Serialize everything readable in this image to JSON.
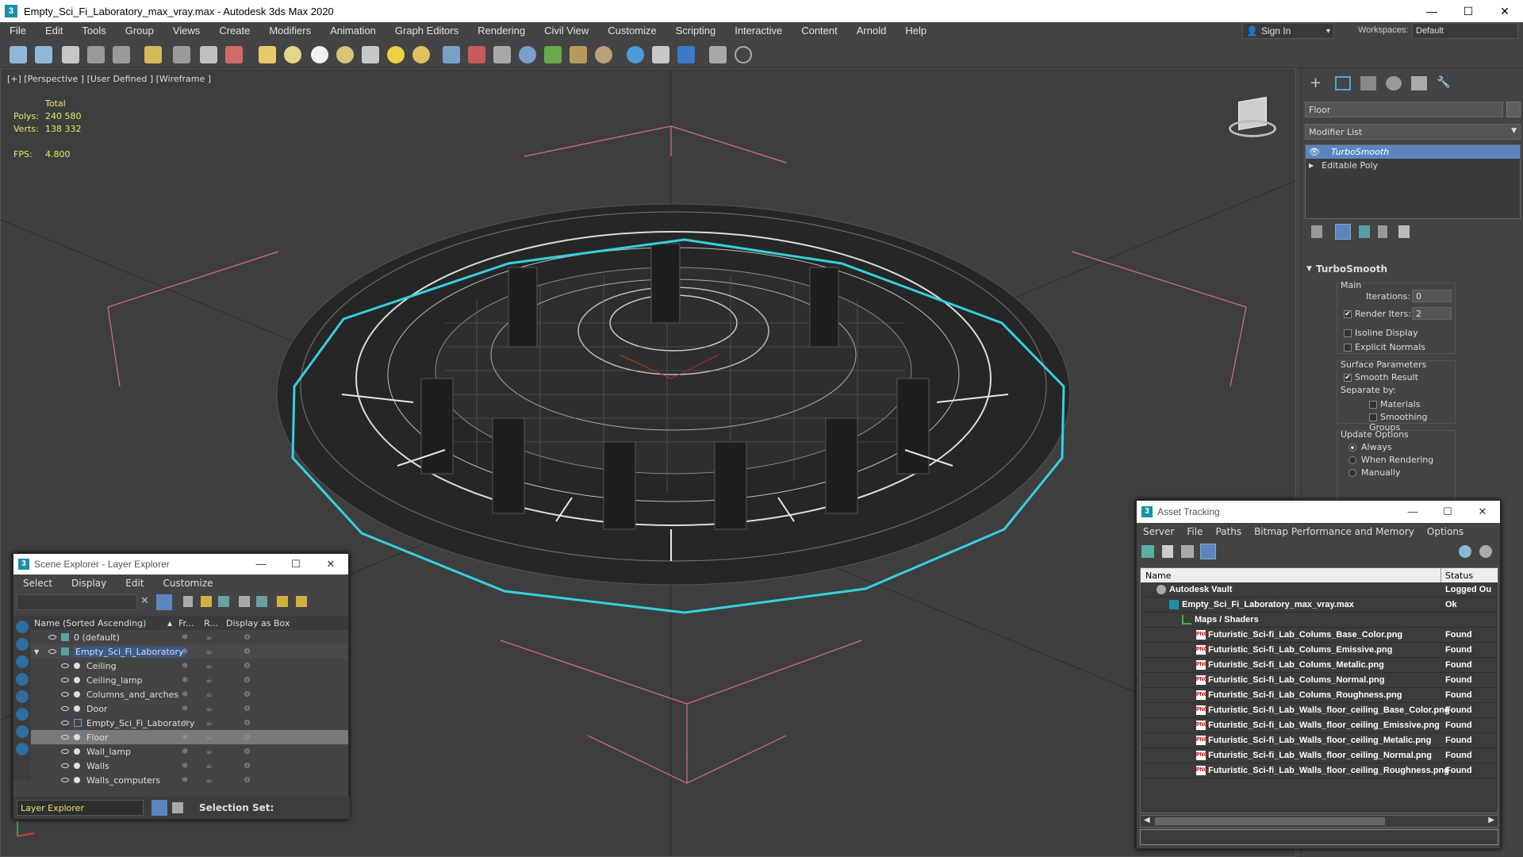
{
  "window": {
    "title": "Empty_Sci_Fi_Laboratory_max_vray.max - Autodesk 3ds Max 2020",
    "minimize": "—",
    "maximize": "☐",
    "close": "✕"
  },
  "menu": [
    "File",
    "Edit",
    "Tools",
    "Group",
    "Views",
    "Create",
    "Modifiers",
    "Animation",
    "Graph Editors",
    "Rendering",
    "Civil View",
    "Customize",
    "Scripting",
    "Interactive",
    "Content",
    "Arnold",
    "Help"
  ],
  "signin": {
    "label": "Sign In",
    "arrow": "▾"
  },
  "workspace": {
    "label": "Workspaces:",
    "value": "Default"
  },
  "viewport": {
    "label": "[+] [Perspective ] [User Defined ] [Wireframe ]",
    "stats": {
      "total_label": "Total",
      "polys_label": "Polys:",
      "polys": "240 580",
      "verts_label": "Verts:",
      "verts": "138 332",
      "fps_label": "FPS:",
      "fps": "4.800"
    }
  },
  "command_panel": {
    "object_name": "Floor",
    "modifier_list": "Modifier List",
    "stack": [
      "TurboSmooth",
      "Editable Poly"
    ],
    "rollout": {
      "title": "TurboSmooth",
      "main": "Main",
      "iterations_label": "Iterations:",
      "iterations": "0",
      "render_iters_label": "Render Iters:",
      "render_iters": "2",
      "isoline": "Isoline Display",
      "explicit": "Explicit Normals",
      "surface": "Surface Parameters",
      "smooth_result": "Smooth Result",
      "separate": "Separate by:",
      "materials": "Materials",
      "smoothing_groups": "Smoothing Groups",
      "update": "Update Options",
      "always": "Always",
      "when_rendering": "When Rendering",
      "manually": "Manually"
    }
  },
  "scene_explorer": {
    "title": "Scene Explorer - Layer Explorer",
    "menu": [
      "Select",
      "Display",
      "Edit",
      "Customize"
    ],
    "columns": [
      "Name (Sorted Ascending)",
      "Fr...",
      "R...",
      "Display as Box"
    ],
    "rows": [
      {
        "name": "0 (default)",
        "level": 1
      },
      {
        "name": "Empty_Sci_Fi_Laboratory",
        "level": 1
      },
      {
        "name": "Ceiling",
        "level": 2
      },
      {
        "name": "Ceiling_lamp",
        "level": 2
      },
      {
        "name": "Columns_and_arches",
        "level": 2
      },
      {
        "name": "Door",
        "level": 2
      },
      {
        "name": "Empty_Sci_Fi_Laboratory",
        "level": 2
      },
      {
        "name": "Floor",
        "level": 2
      },
      {
        "name": "Wall_lamp",
        "level": 2
      },
      {
        "name": "Walls",
        "level": 2
      },
      {
        "name": "Walls_computers",
        "level": 2
      }
    ],
    "footer_layer": "Layer Explorer",
    "selection_set": "Selection Set:"
  },
  "asset_tracking": {
    "title": "Asset Tracking",
    "menu": [
      "Server",
      "File",
      "Paths",
      "Bitmap Performance and Memory",
      "Options"
    ],
    "columns": [
      "Name",
      "Status"
    ],
    "rows": [
      {
        "name": "Autodesk Vault",
        "status": "Logged Ou",
        "level": 1
      },
      {
        "name": "Empty_Sci_Fi_Laboratory_max_vray.max",
        "status": "Ok",
        "level": 2
      },
      {
        "name": "Maps / Shaders",
        "status": "",
        "level": 3
      },
      {
        "name": "Futuristic_Sci-fi_Lab_Colums_Base_Color.png",
        "status": "Found",
        "level": 4
      },
      {
        "name": "Futuristic_Sci-fi_Lab_Colums_Emissive.png",
        "status": "Found",
        "level": 4
      },
      {
        "name": "Futuristic_Sci-fi_Lab_Colums_Metalic.png",
        "status": "Found",
        "level": 4
      },
      {
        "name": "Futuristic_Sci-fi_Lab_Colums_Normal.png",
        "status": "Found",
        "level": 4
      },
      {
        "name": "Futuristic_Sci-fi_Lab_Colums_Roughness.png",
        "status": "Found",
        "level": 4
      },
      {
        "name": "Futuristic_Sci-fi_Lab_Walls_floor_ceiling_Base_Color.png",
        "status": "Found",
        "level": 4
      },
      {
        "name": "Futuristic_Sci-fi_Lab_Walls_floor_ceiling_Emissive.png",
        "status": "Found",
        "level": 4
      },
      {
        "name": "Futuristic_Sci-fi_Lab_Walls_floor_ceiling_Metalic.png",
        "status": "Found",
        "level": 4
      },
      {
        "name": "Futuristic_Sci-fi_Lab_Walls_floor_ceiling_Normal.png",
        "status": "Found",
        "level": 4
      },
      {
        "name": "Futuristic_Sci-fi_Lab_Walls_floor_ceiling_Roughness.png",
        "status": "Found",
        "level": 4
      }
    ]
  },
  "icons": {
    "png": "PNG"
  },
  "colors": {
    "selection_cyan": "#35d0e0",
    "camera_pink": "#d8708a",
    "accent_blue": "#5b85c0",
    "stats_yellow": "#e8e86a"
  }
}
